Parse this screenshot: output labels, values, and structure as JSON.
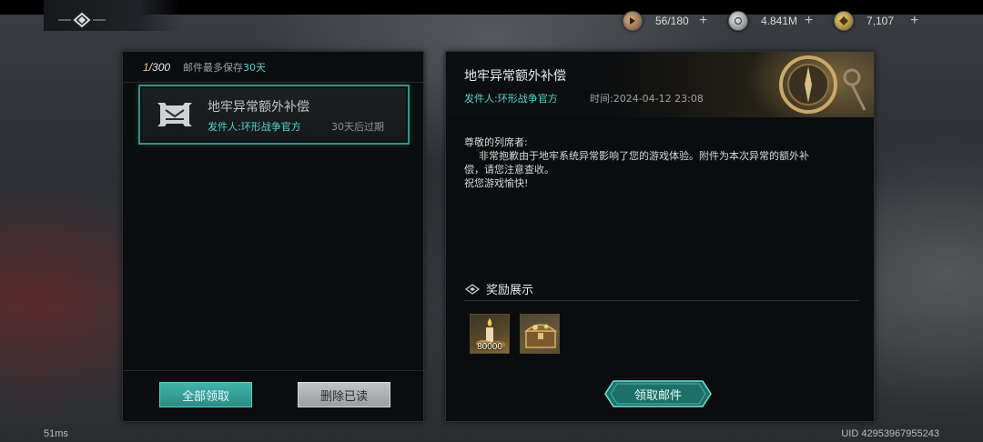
{
  "resources": [
    {
      "icon": "stamina-icon",
      "value": "56/180",
      "color": "#b88a6a"
    },
    {
      "icon": "silver-coin-icon",
      "value": "4.841M",
      "color": "#a7a9aa"
    },
    {
      "icon": "gold-coin-icon",
      "value": "7,107",
      "color": "#c9a94f"
    }
  ],
  "mail_list": {
    "count_current": "1",
    "count_total": "/300",
    "storage_note_prefix": "邮件最多保存",
    "storage_note_days": "30天",
    "items": [
      {
        "title": "地牢异常额外补偿",
        "sender": "发件人:环形战争官方",
        "expire": "30天后过期",
        "icon": "mail-crest-icon"
      }
    ],
    "claim_all_label": "全部领取",
    "delete_read_label": "删除已读"
  },
  "mail_detail": {
    "title": "地牢异常额外补偿",
    "sender": "发件人:环形战争官方",
    "time": "时间:2024-04-12 23:08",
    "body": {
      "greeting": "尊敬的列席者:",
      "line1": "非常抱歉由于地牢系统异常影响了您的游戏体验。附件为本次异常的额外补",
      "line2": "偿，请您注意查收。",
      "closing": "祝您游戏愉快!"
    },
    "reward_title": "奖励展示",
    "rewards": [
      {
        "icon": "candle-coin-icon",
        "quantity": "80000"
      },
      {
        "icon": "treasure-chest-icon",
        "quantity": ""
      }
    ],
    "claim_button_label": "领取邮件"
  },
  "footer": {
    "ping": "51ms",
    "uid": "UID 42953967955243"
  }
}
